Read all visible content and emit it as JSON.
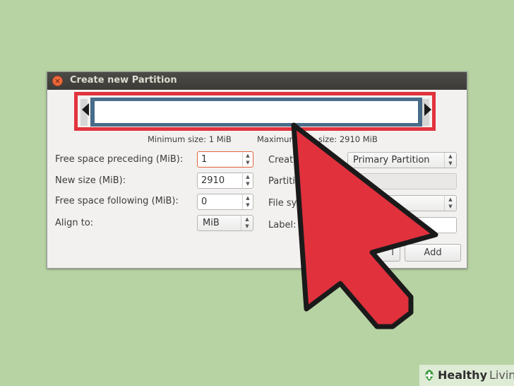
{
  "dialog": {
    "title": "Create new Partition",
    "close_icon": "close-icon",
    "size_info": {
      "minimum": "Minimum size: 1 MiB",
      "maximum_visible_left": "Maximum",
      "maximum_visible_right": "size: 2910 MiB"
    },
    "fields": {
      "free_space_preceding": {
        "label": "Free space preceding (MiB):",
        "value": "1"
      },
      "new_size": {
        "label": "New size (MiB):",
        "value": "2910"
      },
      "free_space_following": {
        "label": "Free space following (MiB):",
        "value": "0"
      },
      "align_to": {
        "label": "Align to:",
        "value": "MiB"
      }
    },
    "right_fields": {
      "create_as": {
        "label_visible": "Create",
        "value": "Primary Partition"
      },
      "partition_name": {
        "label_visible": "Partiti"
      },
      "file_system": {
        "label_visible": "File sys"
      },
      "label": {
        "label": "Label:"
      }
    },
    "buttons": {
      "cancel_visible": "l",
      "add": "Add"
    }
  },
  "overlay": {
    "highlight_color": "#e2333d",
    "arrow_color": "#e0313d"
  },
  "watermark": {
    "part1": "Healthy",
    "part2": "Living"
  }
}
